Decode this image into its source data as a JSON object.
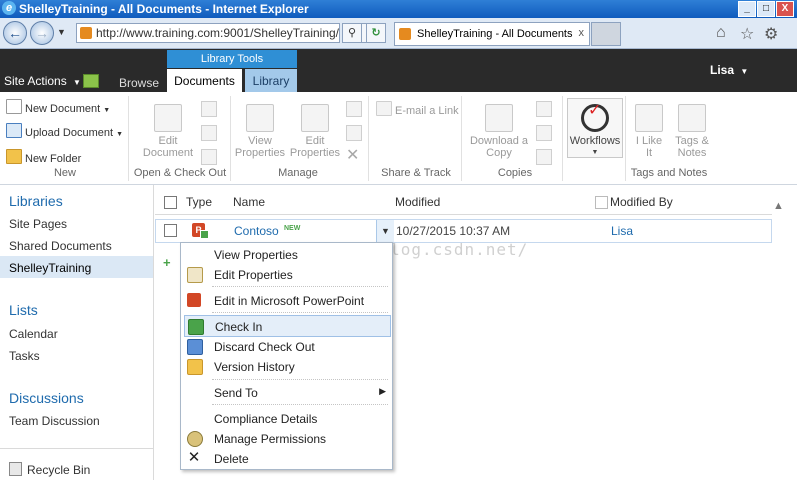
{
  "window": {
    "title": "ShelleyTraining - All Documents - Internet Explorer",
    "controls": [
      "_",
      "□",
      "X"
    ]
  },
  "browser": {
    "url": "http://www.training.com:9001/ShelleyTraining/",
    "tab_label": "ShelleyTraining - All Documents",
    "tab_close": "x"
  },
  "ribbon_top": {
    "site_actions": "Site Actions",
    "browse": "Browse",
    "context_group": "Library Tools",
    "documents": "Documents",
    "library": "Library",
    "user": "Lisa"
  },
  "ribbon": {
    "new_group": {
      "label": "New",
      "new_document": "New Document",
      "upload_document": "Upload Document",
      "new_folder": "New Folder"
    },
    "open_group": {
      "label": "Open & Check Out",
      "edit_document": [
        "Edit",
        "Document"
      ]
    },
    "manage_group": {
      "label": "Manage",
      "view_properties": [
        "View",
        "Properties"
      ],
      "edit_properties": [
        "Edit",
        "Properties"
      ]
    },
    "share_group": {
      "label": "Share & Track",
      "email_link": "E-mail a Link"
    },
    "copies_group": {
      "label": "Copies",
      "download_copy": [
        "Download a",
        "Copy"
      ]
    },
    "workflows_group": {
      "workflows": "Workflows"
    },
    "tags_group": {
      "label": "Tags and Notes",
      "i_like_it": [
        "I Like",
        "It"
      ],
      "tags_notes": [
        "Tags &",
        "Notes"
      ]
    }
  },
  "leftnav": {
    "libraries": "Libraries",
    "library_items": [
      "Site Pages",
      "Shared Documents",
      "ShelleyTraining"
    ],
    "lists": "Lists",
    "list_items": [
      "Calendar",
      "Tasks"
    ],
    "discussions": "Discussions",
    "discussion_items": [
      "Team Discussion"
    ],
    "recycle_bin": "Recycle Bin"
  },
  "list": {
    "columns": [
      "Type",
      "Name",
      "Modified",
      "Modified By"
    ],
    "rows": [
      {
        "name": "Contoso",
        "new_badge": "NEW",
        "modified": "10/27/2015 10:37 AM",
        "modified_by": "Lisa"
      }
    ]
  },
  "context_menu": {
    "items": [
      "View Properties",
      "Edit Properties",
      "Edit in Microsoft PowerPoint",
      "Check In",
      "Discard Check Out",
      "Version History",
      "Send To",
      "Compliance Details",
      "Manage Permissions",
      "Delete"
    ],
    "highlighted": "Check In"
  },
  "watermark": "http://blog.csdn.net/"
}
